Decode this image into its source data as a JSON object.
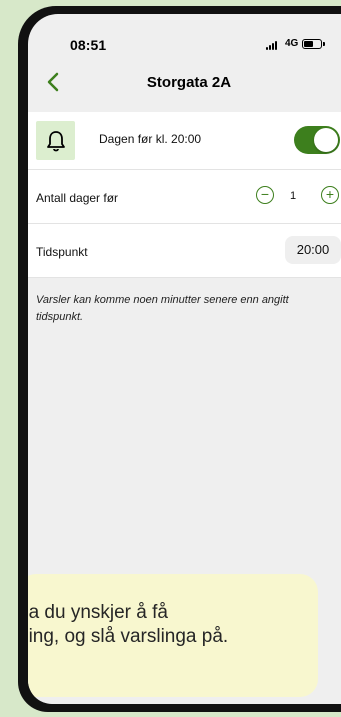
{
  "status_bar": {
    "time": "08:51",
    "network": "4G",
    "icons": [
      "signal-icon",
      "battery-icon"
    ]
  },
  "nav": {
    "title": "Storgata 2A",
    "back_icon": "chevron-left-icon"
  },
  "reminder": {
    "icon": "bell-icon",
    "label": "Dagen før kl. 20:00",
    "enabled": true
  },
  "days_before": {
    "label": "Antall dager før",
    "value": "1",
    "minus_symbol": "−",
    "plus_symbol": "+"
  },
  "time_setting": {
    "label": "Tidspunkt",
    "value": "20:00"
  },
  "note": "Varsler kan komme noen minutter senere enn angitt tidspunkt.",
  "tip": {
    "text": "da du ynskjer å få\nning, og slå varslinga på."
  },
  "colors": {
    "accent": "#3d7f1d",
    "background": "#d7e8c9",
    "tip_background": "#f8f7cf"
  }
}
